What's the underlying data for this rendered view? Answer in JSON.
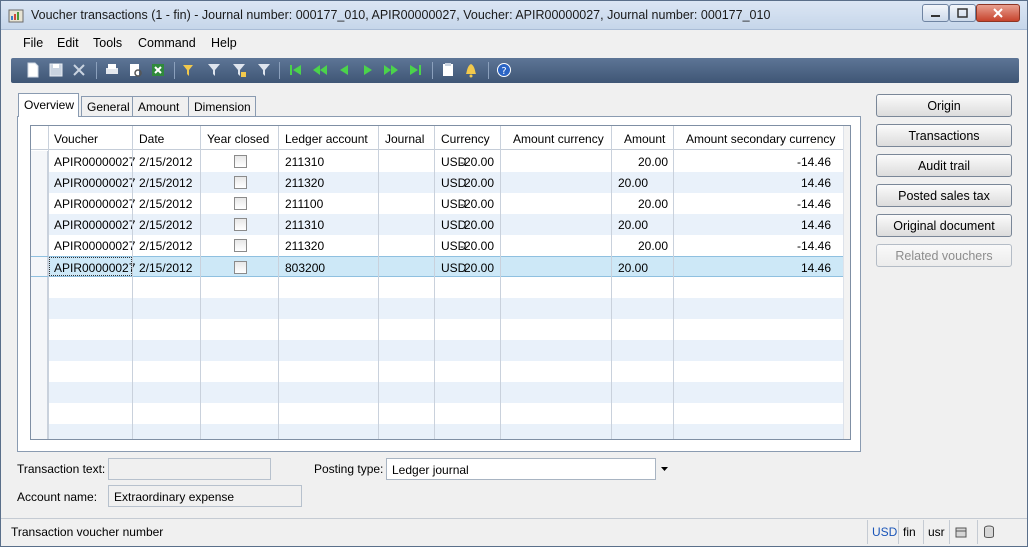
{
  "window": {
    "title": "Voucher transactions (1 - fin) - Journal number: 000177_010, APIR00000027, Voucher: APIR00000027, Journal number: 000177_010"
  },
  "menu": {
    "items": [
      "File",
      "Edit",
      "Tools",
      "Command",
      "Help"
    ]
  },
  "toolbar": {
    "icons": [
      "new-icon",
      "save-icon",
      "delete-icon",
      "print-icon",
      "print-preview-icon",
      "excel-icon",
      "filter-by-selection-icon",
      "filter-by-grid-icon",
      "advanced-filter-icon",
      "remove-filter-icon",
      "first-record-icon",
      "previous-page-icon",
      "previous-record-icon",
      "next-record-icon",
      "next-page-icon",
      "last-record-icon",
      "document-handling-icon",
      "alert-icon",
      "help-icon"
    ]
  },
  "tabs": [
    "Overview",
    "General",
    "Amount",
    "Dimension"
  ],
  "grid": {
    "columns": [
      "Voucher",
      "Date",
      "Year closed",
      "Ledger account",
      "Journal",
      "Currency",
      "Amount currency",
      "Amount",
      "Amount secondary currency"
    ],
    "rows": [
      {
        "voucher": "APIR00000027",
        "date": "2/15/2012",
        "year_closed": false,
        "ledger_account": "211310",
        "journal": "",
        "currency": "USD",
        "amount_currency": "-20.00",
        "amount_debit": "",
        "amount_credit": "20.00",
        "amount_secondary": "-14.46"
      },
      {
        "voucher": "APIR00000027",
        "date": "2/15/2012",
        "year_closed": false,
        "ledger_account": "211320",
        "journal": "",
        "currency": "USD",
        "amount_currency": "20.00",
        "amount_debit": "20.00",
        "amount_credit": "",
        "amount_secondary": "14.46"
      },
      {
        "voucher": "APIR00000027",
        "date": "2/15/2012",
        "year_closed": false,
        "ledger_account": "211100",
        "journal": "",
        "currency": "USD",
        "amount_currency": "-20.00",
        "amount_debit": "",
        "amount_credit": "20.00",
        "amount_secondary": "-14.46"
      },
      {
        "voucher": "APIR00000027",
        "date": "2/15/2012",
        "year_closed": false,
        "ledger_account": "211310",
        "journal": "",
        "currency": "USD",
        "amount_currency": "20.00",
        "amount_debit": "20.00",
        "amount_credit": "",
        "amount_secondary": "14.46"
      },
      {
        "voucher": "APIR00000027",
        "date": "2/15/2012",
        "year_closed": false,
        "ledger_account": "211320",
        "journal": "",
        "currency": "USD",
        "amount_currency": "-20.00",
        "amount_debit": "",
        "amount_credit": "20.00",
        "amount_secondary": "-14.46"
      },
      {
        "voucher": "APIR00000027",
        "date": "2/15/2012",
        "year_closed": false,
        "ledger_account": "803200",
        "journal": "",
        "currency": "USD",
        "amount_currency": "20.00",
        "amount_debit": "20.00",
        "amount_credit": "",
        "amount_secondary": "14.46"
      }
    ],
    "selected_row": 5
  },
  "side_buttons": [
    {
      "label": "Origin",
      "enabled": true
    },
    {
      "label": "Transactions",
      "enabled": true
    },
    {
      "label": "Audit trail",
      "enabled": true
    },
    {
      "label": "Posted sales tax",
      "enabled": true
    },
    {
      "label": "Original document",
      "enabled": true
    },
    {
      "label": "Related vouchers",
      "enabled": false
    }
  ],
  "fields": {
    "transaction_text_label": "Transaction text:",
    "transaction_text_value": "",
    "posting_type_label": "Posting type:",
    "posting_type_value": "Ledger journal",
    "account_name_label": "Account name:",
    "account_name_value": "Extraordinary expense"
  },
  "status": {
    "text": "Transaction voucher number",
    "currency": "USD",
    "company": "fin",
    "layer": "usr"
  },
  "colors": {
    "selected_row": "#cde8f7",
    "alt_row": "#e9f1fa",
    "toolbar": "#4d6585"
  }
}
